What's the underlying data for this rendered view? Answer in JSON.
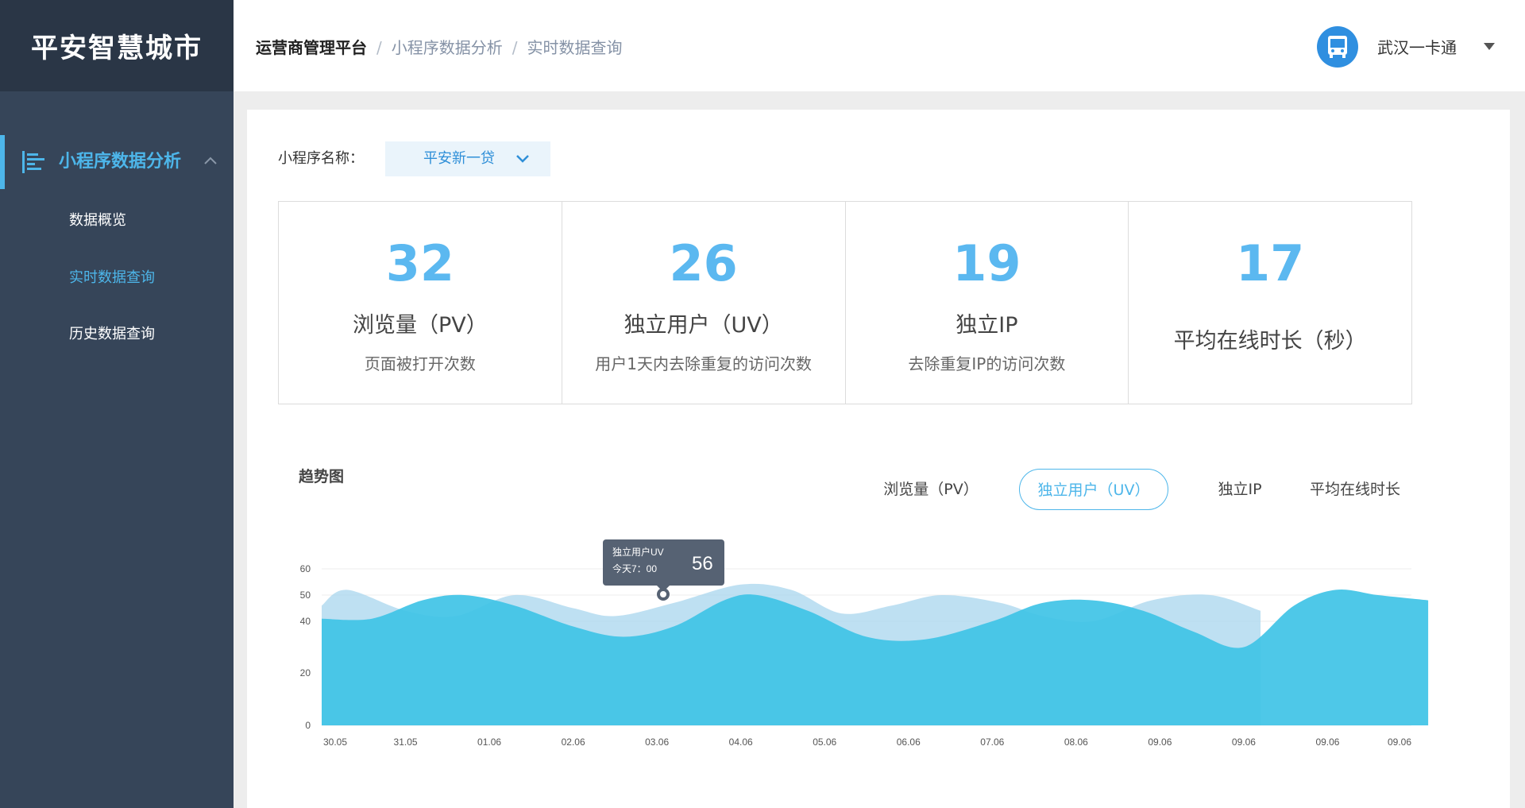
{
  "sidebar": {
    "logo": "平安智慧城市",
    "group_label": "小程序数据分析",
    "items": [
      {
        "label": "数据概览"
      },
      {
        "label": "实时数据查询"
      },
      {
        "label": "历史数据查询"
      }
    ],
    "active_item": 1
  },
  "header": {
    "breadcrumb": [
      "运营商管理平台",
      "小程序数据分析",
      "实时数据查询"
    ],
    "user_name": "武汉一卡通",
    "avatar_icon": "bus-icon"
  },
  "filter": {
    "label": "小程序名称：",
    "selected": "平安新一贷"
  },
  "stats": [
    {
      "value": "32",
      "label": "浏览量（PV）",
      "desc": "页面被打开次数"
    },
    {
      "value": "26",
      "label": "独立用户（UV）",
      "desc": "用户1天内去除重复的访问次数"
    },
    {
      "value": "19",
      "label": "独立IP",
      "desc": "去除重复IP的访问次数"
    },
    {
      "value": "17",
      "label": "平均在线时长（秒）",
      "desc": ""
    }
  ],
  "trend": {
    "title": "趋势图",
    "tabs": [
      "浏览量（PV）",
      "独立用户（UV）",
      "独立IP",
      "平均在线时长"
    ],
    "active_tab": 1
  },
  "colors": {
    "accent": "#4db6ea",
    "sidebar_bg": "#364559",
    "logo_bg": "#2a3646",
    "series_front": "#3fc3e6",
    "series_back": "#aed8ef"
  },
  "chart_data": {
    "type": "area",
    "x_ticks": [
      "30.05",
      "31.05",
      "01.06",
      "02.06",
      "03.06",
      "04.06",
      "05.06",
      "06.06",
      "07.06",
      "08.06",
      "09.06",
      "09.06",
      "09.06",
      "09.06"
    ],
    "y_ticks": [
      "0",
      "20",
      "40",
      "50",
      "60"
    ],
    "series": [
      {
        "values": [
          [
            0,
            46
          ],
          [
            0.3,
            52
          ],
          [
            1,
            44
          ],
          [
            1.6,
            42
          ],
          [
            2.3,
            50
          ],
          [
            3.0,
            45
          ],
          [
            3.5,
            42
          ],
          [
            4.2,
            47
          ],
          [
            5.0,
            54
          ],
          [
            5.6,
            52
          ],
          [
            6.2,
            43
          ],
          [
            6.8,
            46
          ],
          [
            7.4,
            50
          ],
          [
            8.1,
            47
          ],
          [
            8.6,
            42
          ],
          [
            9.2,
            40
          ],
          [
            9.9,
            48
          ],
          [
            10.6,
            50
          ],
          [
            11.2,
            44
          ]
        ]
      },
      {
        "values": [
          [
            0,
            41
          ],
          [
            0.6,
            41
          ],
          [
            1.2,
            48
          ],
          [
            1.7,
            50
          ],
          [
            2.3,
            46
          ],
          [
            3.0,
            38
          ],
          [
            3.6,
            34
          ],
          [
            4.2,
            38
          ],
          [
            4.8,
            48
          ],
          [
            5.2,
            50
          ],
          [
            5.8,
            44
          ],
          [
            6.5,
            34
          ],
          [
            7.2,
            33
          ],
          [
            8.0,
            40
          ],
          [
            8.6,
            47
          ],
          [
            9.2,
            48
          ],
          [
            9.8,
            44
          ],
          [
            10.4,
            36
          ],
          [
            11.0,
            30
          ],
          [
            11.6,
            46
          ],
          [
            12.1,
            52
          ],
          [
            12.6,
            50
          ],
          [
            13.2,
            48
          ]
        ]
      }
    ],
    "tooltip": {
      "series": "独立用户UV",
      "time": "今天7：00",
      "value": "56"
    }
  }
}
